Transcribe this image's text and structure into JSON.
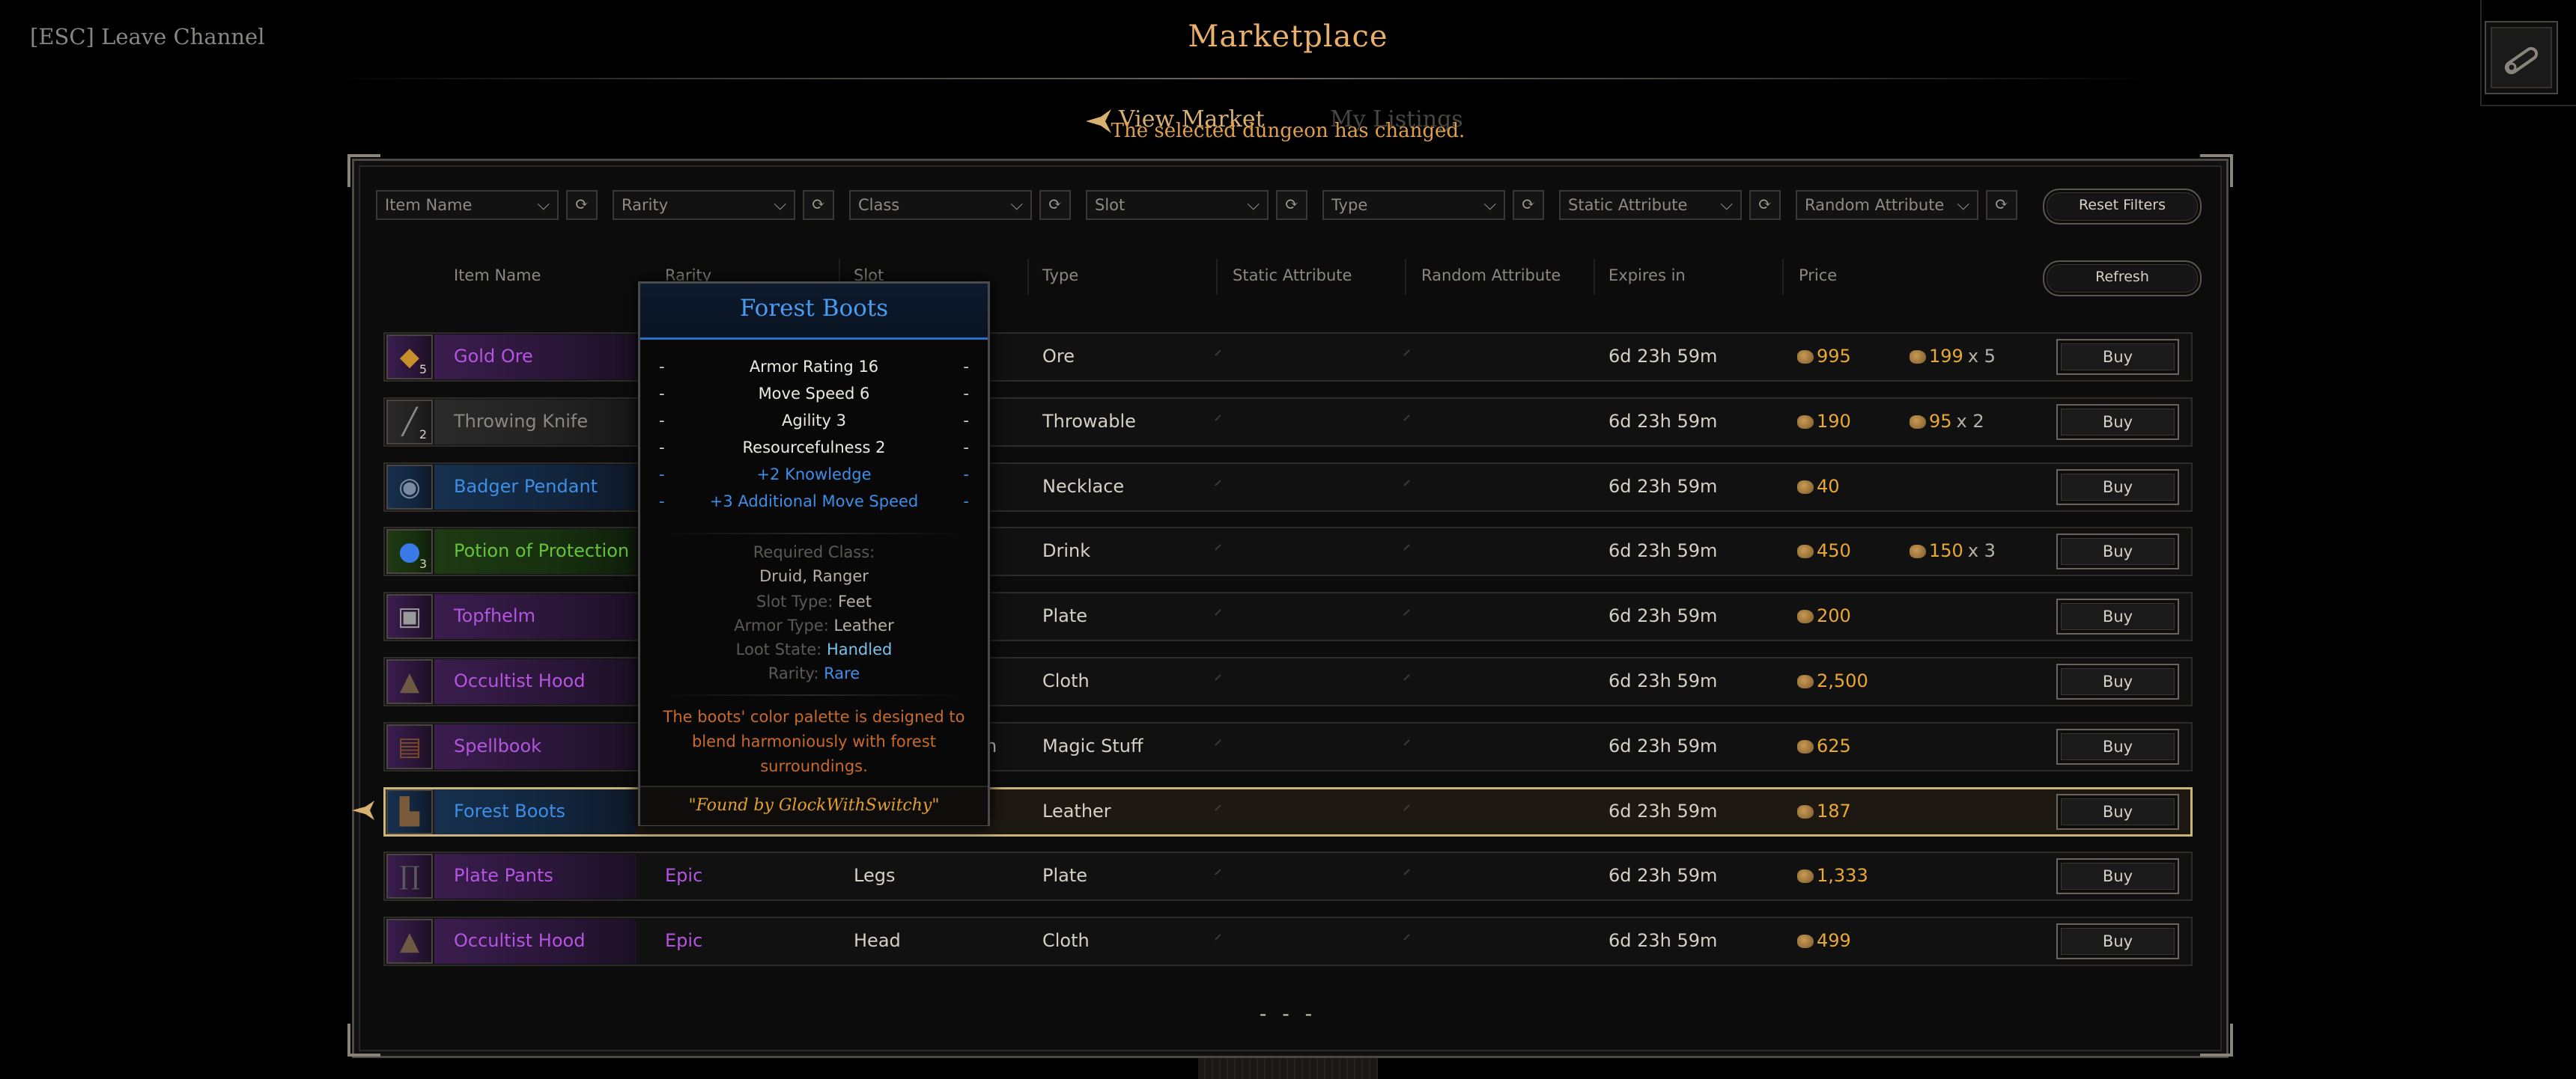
{
  "top_bar": {
    "leave_label": "[ESC] Leave Channel",
    "title": "Marketplace"
  },
  "tabs": {
    "view_market": "View Market",
    "my_listings": "My Listings"
  },
  "toast": "The selected dungeon has changed.",
  "filters": {
    "item_name": "Item Name",
    "rarity": "Rarity",
    "class": "Class",
    "slot": "Slot",
    "type": "Type",
    "static_attribute": "Static Attribute",
    "random_attribute": "Random Attribute",
    "reset_label": "Reset Filters"
  },
  "headers": {
    "item_name": "Item Name",
    "rarity": "Rarity",
    "slot": "Slot",
    "type": "Type",
    "static_attribute": "Static Attribute",
    "random_attribute": "Random Attribute",
    "expires": "Expires in",
    "price": "Price",
    "refresh_label": "Refresh"
  },
  "rows": [
    {
      "name": "Gold Ore",
      "quality": "epic",
      "stack": "5",
      "rarity": "",
      "slot": "",
      "type": "Ore",
      "expires": "6d 23h 59m",
      "price": "995",
      "each_price": "199",
      "each_qty": "x 5",
      "buy": "Buy",
      "icon": "gold-ore-icon"
    },
    {
      "name": "Throwing Knife",
      "quality": "common",
      "stack": "2",
      "rarity": "",
      "slot": "",
      "type": "Throwable",
      "expires": "6d 23h 59m",
      "price": "190",
      "each_price": "95",
      "each_qty": "x 2",
      "buy": "Buy",
      "icon": "throwing-knife-icon"
    },
    {
      "name": "Badger Pendant",
      "quality": "rare",
      "stack": "",
      "rarity": "",
      "slot": "",
      "type": "Necklace",
      "expires": "6d 23h 59m",
      "price": "40",
      "each_price": "",
      "each_qty": "",
      "buy": "Buy",
      "icon": "pendant-icon"
    },
    {
      "name": "Potion of Protection",
      "quality": "uncommon",
      "stack": "3",
      "rarity": "",
      "slot": "",
      "type": "Drink",
      "expires": "6d 23h 59m",
      "price": "450",
      "each_price": "150",
      "each_qty": "x 3",
      "buy": "Buy",
      "icon": "potion-icon"
    },
    {
      "name": "Topfhelm",
      "quality": "epic",
      "stack": "",
      "rarity": "",
      "slot": "",
      "type": "Plate",
      "expires": "6d 23h 59m",
      "price": "200",
      "each_price": "",
      "each_qty": "",
      "buy": "Buy",
      "icon": "helmet-icon"
    },
    {
      "name": "Occultist Hood",
      "quality": "epic",
      "stack": "",
      "rarity": "",
      "slot": "",
      "type": "Cloth",
      "expires": "6d 23h 59m",
      "price": "2,500",
      "each_price": "",
      "each_qty": "",
      "buy": "Buy",
      "icon": "hood-icon"
    },
    {
      "name": "Spellbook",
      "quality": "epic",
      "stack": "",
      "rarity": "",
      "slot": "n",
      "type": "Magic Stuff",
      "expires": "6d 23h 59m",
      "price": "625",
      "each_price": "",
      "each_qty": "",
      "buy": "Buy",
      "icon": "spellbook-icon"
    },
    {
      "name": "Forest Boots",
      "quality": "rare",
      "stack": "",
      "rarity": "",
      "slot": "",
      "type": "Leather",
      "expires": "6d 23h 59m",
      "price": "187",
      "each_price": "",
      "each_qty": "",
      "buy": "Buy",
      "icon": "boots-icon",
      "selected": true
    },
    {
      "name": "Plate Pants",
      "quality": "epic",
      "stack": "",
      "rarity": "Epic",
      "slot": "Legs",
      "type": "Plate",
      "expires": "6d 23h 59m",
      "price": "1,333",
      "each_price": "",
      "each_qty": "",
      "buy": "Buy",
      "icon": "pants-icon"
    },
    {
      "name": "Occultist Hood",
      "quality": "epic",
      "stack": "",
      "rarity": "Epic",
      "slot": "Head",
      "type": "Cloth",
      "expires": "6d 23h 59m",
      "price": "499",
      "each_price": "",
      "each_qty": "",
      "buy": "Buy",
      "icon": "hood-icon"
    }
  ],
  "pager": "- - -",
  "tooltip": {
    "title": "Forest Boots",
    "stats": [
      {
        "text": "Armor Rating 16",
        "kind": "white"
      },
      {
        "text": "Move Speed 6",
        "kind": "white"
      },
      {
        "text": "Agility 3",
        "kind": "white"
      },
      {
        "text": "Resourcefulness 2",
        "kind": "white"
      },
      {
        "text": "+2 Knowledge",
        "kind": "blue"
      },
      {
        "text": "+3 Additional Move Speed",
        "kind": "blue"
      }
    ],
    "dash": "-",
    "required_class_label": "Required Class:",
    "required_class_value": "Druid, Ranger",
    "slot_type_label": "Slot Type:",
    "slot_type_value": "Feet",
    "armor_type_label": "Armor Type:",
    "armor_type_value": "Leather",
    "loot_state_label": "Loot State:",
    "loot_state_value": "Handled",
    "rarity_label": "Rarity:",
    "rarity_value": "Rare",
    "description": "The boots' color palette is designed to blend harmoniously with forest surroundings.",
    "found_by": "\"Found by GlockWithSwitchy\""
  },
  "colors": {
    "epic": "#b554e0",
    "rare": "#3e8ee8",
    "uncommon": "#66c23a",
    "common": "#8a8682",
    "gold": "#e8a832",
    "title": "#e8b06a"
  }
}
